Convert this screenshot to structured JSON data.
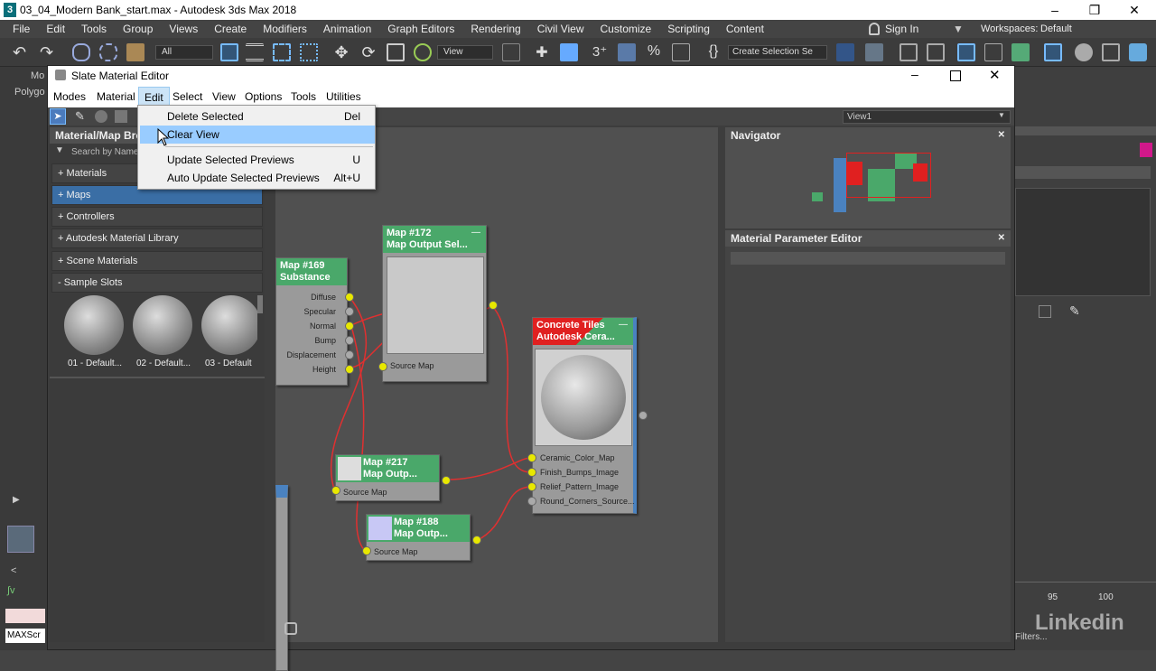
{
  "app": {
    "title": "03_04_Modern Bank_start.max - Autodesk 3ds Max 2018",
    "menus": [
      "File",
      "Edit",
      "Tools",
      "Group",
      "Views",
      "Create",
      "Modifiers",
      "Animation",
      "Graph Editors",
      "Rendering",
      "Civil View",
      "Customize",
      "Scripting",
      "Content"
    ],
    "sign_in": "Sign In",
    "workspaces_label": "Workspaces:",
    "workspaces_value": "Default",
    "selection_filter": "All",
    "ref_coord": "View",
    "create_selection_set": "Create Selection Se"
  },
  "slate": {
    "title": "Slate Material Editor",
    "menus": [
      "Modes",
      "Material",
      "Edit",
      "Select",
      "View",
      "Options",
      "Tools",
      "Utilities"
    ],
    "view_name": "View1",
    "browser": {
      "title": "Material/Map Bro",
      "search_placeholder": "Search by Name ...",
      "categories": [
        "+ Materials",
        "+ Maps",
        "+ Controllers",
        "+ Autodesk Material Library",
        "+ Scene Materials",
        "- Sample Slots"
      ],
      "sample_slots": [
        "01 - Default...",
        "02 - Default...",
        "03 - Default"
      ]
    },
    "edit_menu": {
      "items": [
        {
          "label": "Delete Selected",
          "shortcut": "Del"
        },
        {
          "label": "Clear View",
          "shortcut": ""
        },
        {
          "label": "Update Selected Previews",
          "shortcut": "U"
        },
        {
          "label": "Auto Update Selected Previews",
          "shortcut": "Alt+U"
        }
      ]
    },
    "navigator_title": "Navigator",
    "param_editor_title": "Material Parameter Editor",
    "nodes": {
      "n169": {
        "title1": "Map #169",
        "title2": "Substance",
        "slots": [
          "Diffuse",
          "Specular",
          "Normal",
          "Bump",
          "Displacement",
          "Height"
        ]
      },
      "n172": {
        "title1": "Map #172",
        "title2": "Map Output Sel...",
        "slot": "Source Map"
      },
      "concrete": {
        "title1": "Concrete Tiles",
        "title2": "Autodesk Cera...",
        "slots": [
          "Ceramic_Color_Map",
          "Finish_Bumps_Image",
          "Relief_Pattern_Image",
          "Round_Corners_Source..."
        ]
      },
      "n217": {
        "title1": "Map #217",
        "title2": "Map Outp...",
        "slot": "Source Map"
      },
      "n188": {
        "title1": "Map #188",
        "title2": "Map Outp...",
        "slot": "Source Map"
      }
    }
  },
  "right_panel": {
    "ruler_a": "95",
    "ruler_b": "100",
    "filters": "Filters..."
  },
  "left_strip": {
    "tabs": [
      "Mo",
      "Polygo"
    ],
    "maxscript": "MAXScr"
  },
  "watermark": "Linkedin",
  "colors": {
    "node_header": "#4aa86a",
    "material_header": "#e02020",
    "highlight": "#99ccff",
    "wire": "#e03030",
    "socket": "#e8e800"
  }
}
